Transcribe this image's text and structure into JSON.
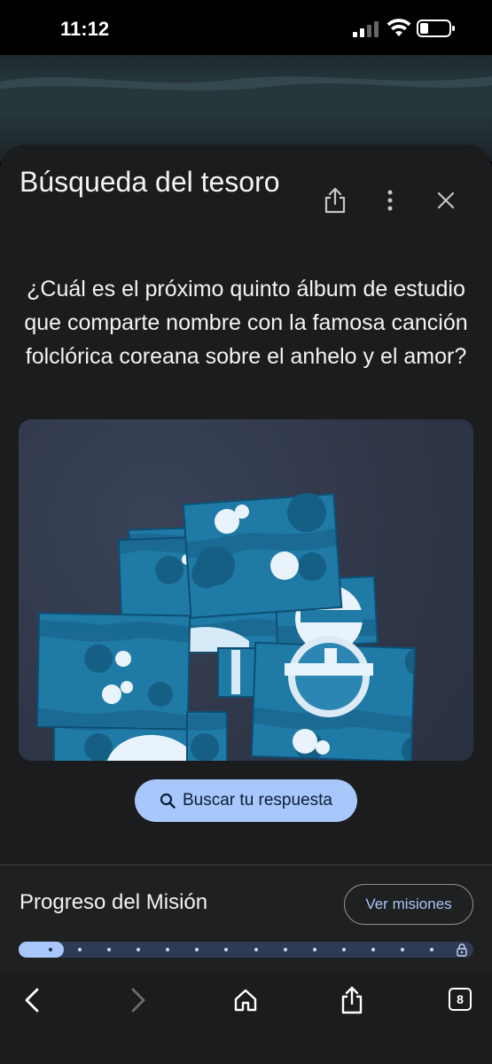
{
  "status_bar": {
    "time": "11:12"
  },
  "sheet": {
    "title": "Búsqueda del tesoro",
    "question": "¿Cuál es el próximo quinto álbum de estudio que comparte nombre con la famosa canción folclórica coreana sobre el anhelo y el amor?",
    "search_button_label": "Buscar tu respuesta",
    "icons": [
      "share-icon",
      "more-vert-icon",
      "close-icon",
      "search-icon"
    ]
  },
  "progress": {
    "title": "Progreso del Misión",
    "missions_button_label": "Ver misiones",
    "completed_fraction": 0.1,
    "steps_total": 14,
    "end_icon": "lock-icon"
  },
  "toolbar": {
    "tab_count": "8",
    "icons": [
      "back-icon",
      "forward-icon",
      "home-icon",
      "share-icon",
      "tabs-icon"
    ]
  },
  "colors": {
    "accent": "#a8c7fa",
    "sheet_bg": "#1b1c1e",
    "progress_track": "#2f3a55"
  }
}
